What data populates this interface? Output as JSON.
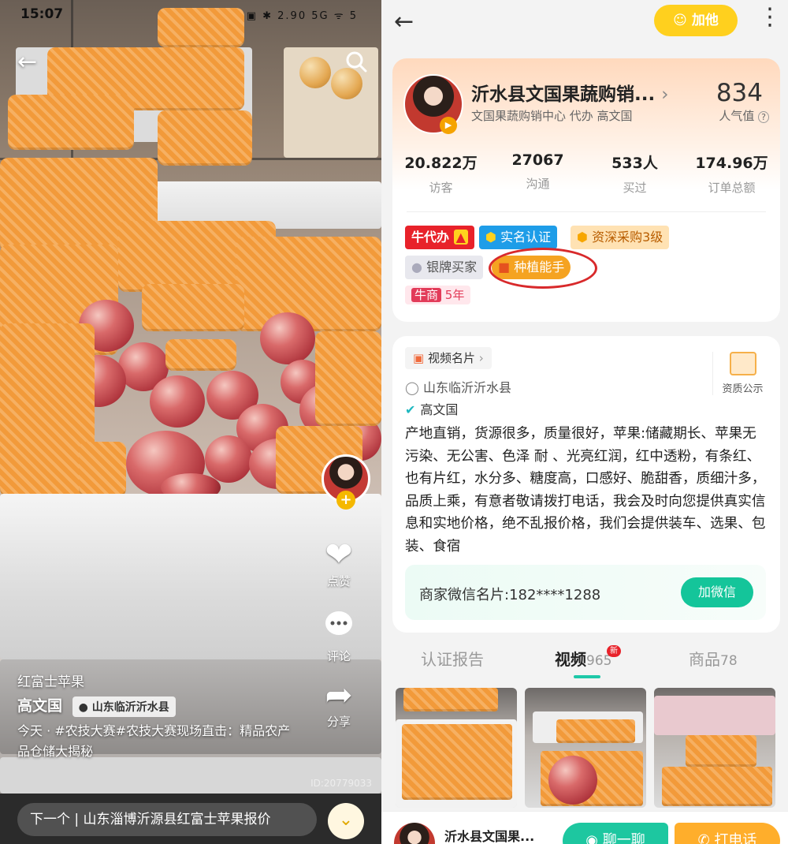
{
  "left": {
    "status_time": "15:07",
    "status_icons": "▣ ✱ 2.90 5G ᯤ 5",
    "side": {
      "like": "点赞",
      "comment": "评论",
      "share": "分享"
    },
    "caption": {
      "title": "红富士苹果",
      "author": "高文国",
      "location": "山东临沂沂水县",
      "text": "今天 · #农技大赛#农技大赛现场直击：精品农产品仓储大揭秘"
    },
    "watermark": "ID:20779033",
    "next": "下一个 | 山东淄博沂源县红富士苹果报价"
  },
  "right": {
    "add_label": "加他",
    "shop": {
      "name": "沂水县文国果蔬购销...",
      "sub": "文国果蔬购销中心  代办  高文国",
      "popularity": "834",
      "popularity_label": "人气值"
    },
    "stats": [
      {
        "value": "20.822万",
        "label": "访客"
      },
      {
        "value": "27067",
        "label": "沟通"
      },
      {
        "value": "533人",
        "label": "买过"
      },
      {
        "value": "174.96万",
        "label": "订单总额"
      }
    ],
    "badges": {
      "b1": "牛代办",
      "b2": "实名认证",
      "b3": "资深采购3级",
      "b4": "银牌买家",
      "b5": "种植能手",
      "b6": "牛商",
      "b6_years": "5年"
    },
    "card": {
      "video_card": "视频名片",
      "qualification": "资质公示",
      "location": "山东临沂沂水县",
      "owner": "高文国",
      "description": "产地直销，货源很多，质量很好，苹果:储藏期长、苹果无污染、无公害、色泽 耐 、光亮红润，红中透粉，有条红、也有片红，水分多、糖度高，口感好、脆甜香，质细汁多，品质上乘，有意者敬请拨打电话，我会及时向您提供真实信息和实地价格，绝不乱报价格，我们会提供装车、选果、包装、食宿",
      "wechat_text": "商家微信名片:182****1288",
      "wechat_button": "加微信"
    },
    "tabs": {
      "t1": "认证报告",
      "t2": "视频",
      "t2_count": "965",
      "t2_new": "新",
      "t3": "商品",
      "t3_count": "78"
    },
    "bottom": {
      "name": "沂水县文国果...",
      "chat": "聊一聊",
      "call": "打电话"
    }
  }
}
